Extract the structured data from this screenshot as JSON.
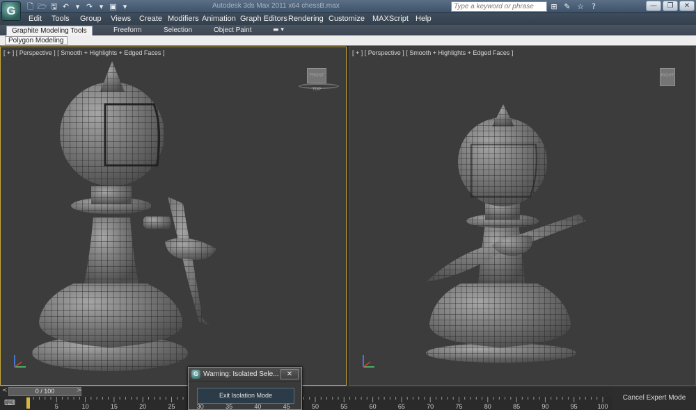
{
  "titlebar": {
    "logo_text": "G",
    "qat_icons": [
      "new-file-icon",
      "open-folder-icon",
      "save-icon",
      "undo-icon",
      "redo-icon",
      "project-folder-icon"
    ],
    "qat_glyphs": [
      "🗋",
      "🗁",
      "🖫",
      "↶",
      "▾",
      "↷",
      "▾",
      "▣",
      "▾"
    ],
    "window_title": "Autodesk 3ds Max 2011 x64     chessB.max",
    "search_placeholder": "Type a keyword or phrase",
    "search_tools": [
      "⊞",
      "✎",
      "☆",
      "?"
    ],
    "window_controls": [
      "—",
      "❐",
      "✕"
    ]
  },
  "menu": {
    "items": [
      "Edit",
      "Tools",
      "Group",
      "Views",
      "Create",
      "Modifiers",
      "Animation",
      "Graph Editors",
      "Rendering",
      "Customize",
      "MAXScript",
      "Help"
    ]
  },
  "ribbon": {
    "tabs": [
      "Graphite Modeling Tools",
      "Freeform",
      "Selection",
      "Object Paint"
    ],
    "options_glyph": "▬ ▾",
    "panel_label": "Polygon Modeling"
  },
  "viewports": {
    "left": {
      "label": "[ + ] [ Perspective ] [ Smooth + Highlights + Edged Faces ]",
      "viewcube_text": "FRONT TOP"
    },
    "right": {
      "label": "[ + ] [ Perspective ] [ Smooth + Highlights + Edged Faces ]",
      "viewcube_text": "RIGHT"
    }
  },
  "timeline": {
    "frame_display": "0 / 100",
    "prev_arrow": "<",
    "next_arrow": ">",
    "ticks": [
      "5",
      "10",
      "15",
      "20",
      "25",
      "30",
      "35",
      "40",
      "45",
      "50",
      "55",
      "60",
      "65",
      "70",
      "75",
      "80",
      "85",
      "90",
      "95",
      "100"
    ],
    "track_icon": "⌨"
  },
  "cancel_expert_label": "Cancel Expert Mode",
  "isolation_dialog": {
    "title": "Warning: Isolated Sele...",
    "close_label": "✕",
    "exit_button": "Exit Isolation Mode",
    "icon_text": "G"
  },
  "colors": {
    "active_viewport_border": "#c8a93c",
    "viewport_bg": "#3c3c3c",
    "title_bar": "#4b5f76"
  }
}
